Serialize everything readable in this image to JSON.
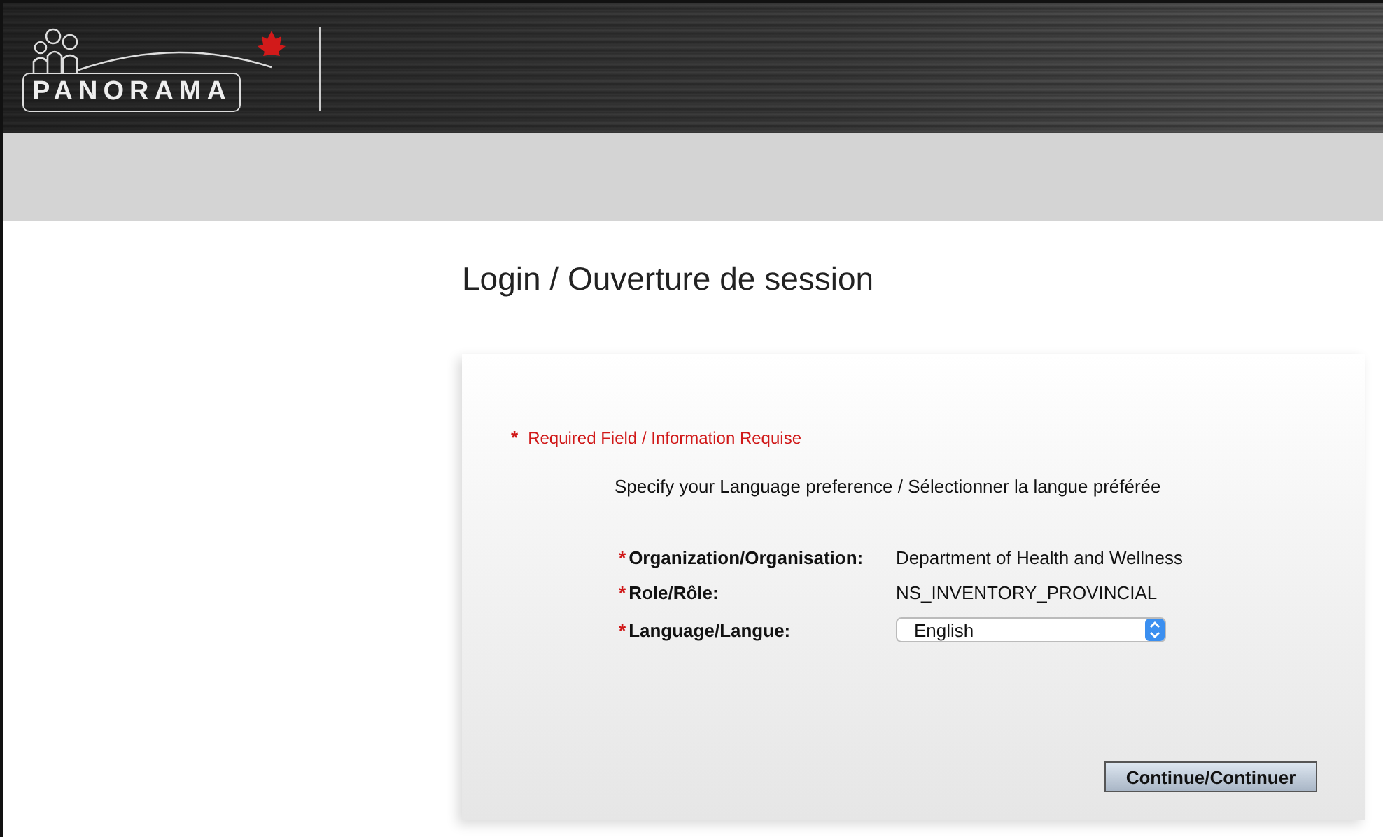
{
  "header": {
    "logo_text": "PANORAMA"
  },
  "title": "Login / Ouverture de session",
  "required_note": {
    "marker": "*",
    "text": "Required Field / Information Requise"
  },
  "instruction": "Specify your Language preference / Sélectionner la langue préférée",
  "fields": [
    {
      "kind": "text",
      "marker": "*",
      "label": "Organization/Organisation:",
      "value": "Department of Health and Wellness"
    },
    {
      "kind": "text",
      "marker": "*",
      "label": "Role/Rôle:",
      "value": "NS_INVENTORY_PROVINCIAL"
    },
    {
      "kind": "select",
      "marker": "*",
      "label": "Language/Langue:",
      "value": "English"
    }
  ],
  "button": "Continue/Continuer"
}
